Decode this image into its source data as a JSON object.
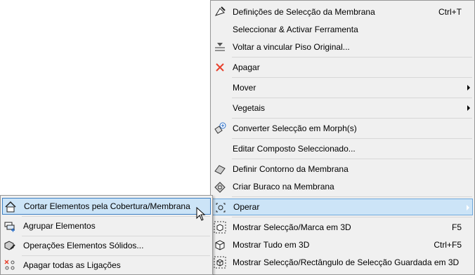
{
  "main_menu": {
    "items": [
      {
        "label": "Definições de Selecção da Membrana",
        "shortcut": "Ctrl+T",
        "icon": "membrane-settings-icon"
      },
      {
        "label": "Seleccionar & Activar Ferramenta",
        "shortcut": "",
        "icon": ""
      },
      {
        "label": "Voltar a vincular Piso Original...",
        "shortcut": "",
        "icon": "relink-floor-icon"
      },
      {
        "label": "Apagar",
        "shortcut": "",
        "icon": "delete-x-icon"
      },
      {
        "label": "Mover",
        "shortcut": "",
        "icon": ""
      },
      {
        "label": "Vegetais",
        "shortcut": "",
        "icon": ""
      },
      {
        "label": "Converter Selecção em Morph(s)",
        "shortcut": "",
        "icon": "convert-morph-icon"
      },
      {
        "label": "Editar Composto Seleccionado...",
        "shortcut": "",
        "icon": ""
      },
      {
        "label": "Definir Contorno da Membrana",
        "shortcut": "",
        "icon": "membrane-contour-icon"
      },
      {
        "label": "Criar Buraco na Membrana",
        "shortcut": "",
        "icon": "membrane-hole-icon"
      },
      {
        "label": "Operar",
        "shortcut": "",
        "icon": "operate-icon"
      },
      {
        "label": "Mostrar Selecção/Marca em 3D",
        "shortcut": "F5",
        "icon": "show-selection-3d-icon"
      },
      {
        "label": "Mostrar Tudo em 3D",
        "shortcut": "Ctrl+F5",
        "icon": "show-all-3d-icon"
      },
      {
        "label": "Mostrar Selecção/Rectângulo de Selecção Guardada em 3D",
        "shortcut": "",
        "icon": "show-marquee-3d-icon"
      }
    ]
  },
  "sub_menu": {
    "items": [
      {
        "label": "Cortar Elementos pela Cobertura/Membrana",
        "icon": "trim-roof-icon"
      },
      {
        "label": "Agrupar Elementos",
        "icon": "group-elements-icon"
      },
      {
        "label": "Operações Elementos Sólidos...",
        "icon": "solid-operations-icon"
      },
      {
        "label": "Apagar todas as Ligações",
        "icon": "delete-connections-icon"
      }
    ]
  },
  "colors": {
    "highlight": "#cce4f7",
    "delete_icon": "#e8412c"
  }
}
